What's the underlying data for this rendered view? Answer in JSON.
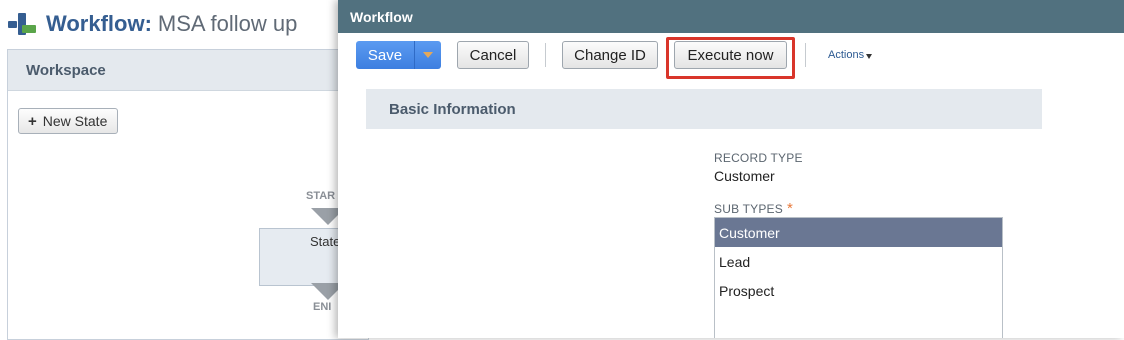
{
  "background": {
    "title_strong": "Workflow:",
    "title_rest": "MSA follow up",
    "workspace": {
      "header": "Workspace",
      "new_state_label": "New State",
      "diagram": {
        "start_label": "STAR",
        "state_label": "State",
        "end_label": "ENI"
      }
    }
  },
  "modal": {
    "title": "Workflow",
    "toolbar": {
      "save_label": "Save",
      "cancel_label": "Cancel",
      "change_id_label": "Change ID",
      "execute_now_label": "Execute now",
      "actions_label": "Actions"
    },
    "section_title": "Basic Information",
    "record_type": {
      "label": "RECORD TYPE",
      "value": "Customer"
    },
    "sub_types": {
      "label": "SUB TYPES",
      "required_mark": "*",
      "options": [
        "Customer",
        "Lead",
        "Prospect"
      ],
      "selected": "Customer"
    }
  },
  "colors": {
    "modal_header": "#51717f",
    "save_button": "#4a8ae8",
    "highlight": "#d9352a",
    "selected_option": "#6a7793",
    "section_bar": "#e4e9ee"
  },
  "icons": {
    "title": "workflow-icon",
    "new_state": "plus-icon",
    "save_dropdown": "chevron-down-icon",
    "actions": "caret-down-icon"
  }
}
